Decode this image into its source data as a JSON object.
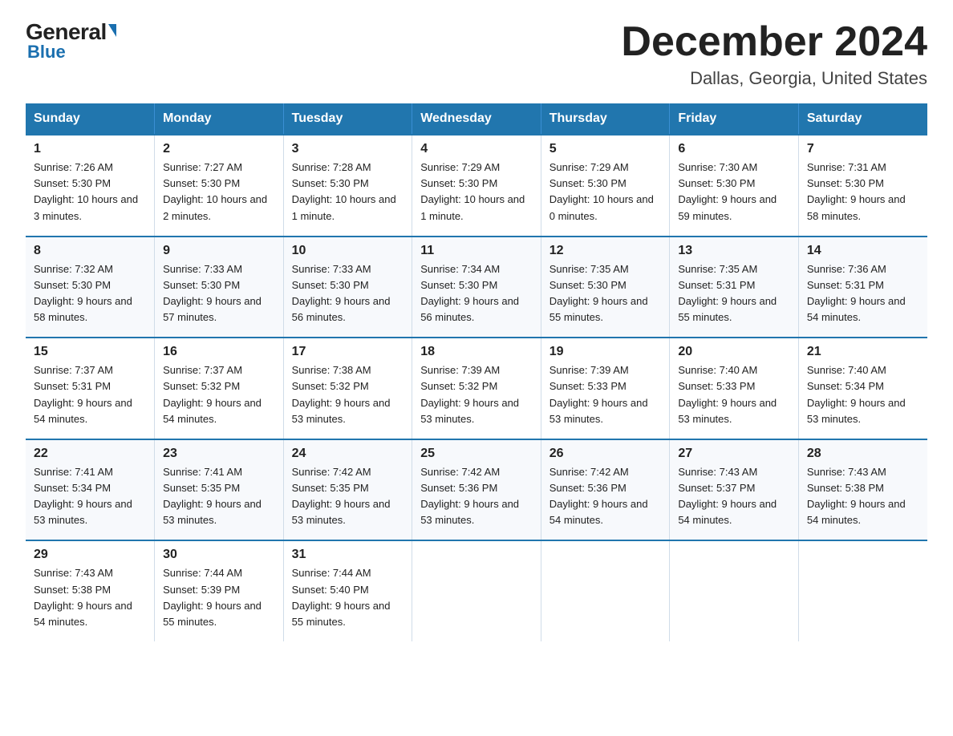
{
  "header": {
    "logo_general": "General",
    "logo_blue": "Blue",
    "title": "December 2024",
    "subtitle": "Dallas, Georgia, United States"
  },
  "days_of_week": [
    "Sunday",
    "Monday",
    "Tuesday",
    "Wednesday",
    "Thursday",
    "Friday",
    "Saturday"
  ],
  "weeks": [
    [
      {
        "day": "1",
        "sunrise": "7:26 AM",
        "sunset": "5:30 PM",
        "daylight": "10 hours and 3 minutes."
      },
      {
        "day": "2",
        "sunrise": "7:27 AM",
        "sunset": "5:30 PM",
        "daylight": "10 hours and 2 minutes."
      },
      {
        "day": "3",
        "sunrise": "7:28 AM",
        "sunset": "5:30 PM",
        "daylight": "10 hours and 1 minute."
      },
      {
        "day": "4",
        "sunrise": "7:29 AM",
        "sunset": "5:30 PM",
        "daylight": "10 hours and 1 minute."
      },
      {
        "day": "5",
        "sunrise": "7:29 AM",
        "sunset": "5:30 PM",
        "daylight": "10 hours and 0 minutes."
      },
      {
        "day": "6",
        "sunrise": "7:30 AM",
        "sunset": "5:30 PM",
        "daylight": "9 hours and 59 minutes."
      },
      {
        "day": "7",
        "sunrise": "7:31 AM",
        "sunset": "5:30 PM",
        "daylight": "9 hours and 58 minutes."
      }
    ],
    [
      {
        "day": "8",
        "sunrise": "7:32 AM",
        "sunset": "5:30 PM",
        "daylight": "9 hours and 58 minutes."
      },
      {
        "day": "9",
        "sunrise": "7:33 AM",
        "sunset": "5:30 PM",
        "daylight": "9 hours and 57 minutes."
      },
      {
        "day": "10",
        "sunrise": "7:33 AM",
        "sunset": "5:30 PM",
        "daylight": "9 hours and 56 minutes."
      },
      {
        "day": "11",
        "sunrise": "7:34 AM",
        "sunset": "5:30 PM",
        "daylight": "9 hours and 56 minutes."
      },
      {
        "day": "12",
        "sunrise": "7:35 AM",
        "sunset": "5:30 PM",
        "daylight": "9 hours and 55 minutes."
      },
      {
        "day": "13",
        "sunrise": "7:35 AM",
        "sunset": "5:31 PM",
        "daylight": "9 hours and 55 minutes."
      },
      {
        "day": "14",
        "sunrise": "7:36 AM",
        "sunset": "5:31 PM",
        "daylight": "9 hours and 54 minutes."
      }
    ],
    [
      {
        "day": "15",
        "sunrise": "7:37 AM",
        "sunset": "5:31 PM",
        "daylight": "9 hours and 54 minutes."
      },
      {
        "day": "16",
        "sunrise": "7:37 AM",
        "sunset": "5:32 PM",
        "daylight": "9 hours and 54 minutes."
      },
      {
        "day": "17",
        "sunrise": "7:38 AM",
        "sunset": "5:32 PM",
        "daylight": "9 hours and 53 minutes."
      },
      {
        "day": "18",
        "sunrise": "7:39 AM",
        "sunset": "5:32 PM",
        "daylight": "9 hours and 53 minutes."
      },
      {
        "day": "19",
        "sunrise": "7:39 AM",
        "sunset": "5:33 PM",
        "daylight": "9 hours and 53 minutes."
      },
      {
        "day": "20",
        "sunrise": "7:40 AM",
        "sunset": "5:33 PM",
        "daylight": "9 hours and 53 minutes."
      },
      {
        "day": "21",
        "sunrise": "7:40 AM",
        "sunset": "5:34 PM",
        "daylight": "9 hours and 53 minutes."
      }
    ],
    [
      {
        "day": "22",
        "sunrise": "7:41 AM",
        "sunset": "5:34 PM",
        "daylight": "9 hours and 53 minutes."
      },
      {
        "day": "23",
        "sunrise": "7:41 AM",
        "sunset": "5:35 PM",
        "daylight": "9 hours and 53 minutes."
      },
      {
        "day": "24",
        "sunrise": "7:42 AM",
        "sunset": "5:35 PM",
        "daylight": "9 hours and 53 minutes."
      },
      {
        "day": "25",
        "sunrise": "7:42 AM",
        "sunset": "5:36 PM",
        "daylight": "9 hours and 53 minutes."
      },
      {
        "day": "26",
        "sunrise": "7:42 AM",
        "sunset": "5:36 PM",
        "daylight": "9 hours and 54 minutes."
      },
      {
        "day": "27",
        "sunrise": "7:43 AM",
        "sunset": "5:37 PM",
        "daylight": "9 hours and 54 minutes."
      },
      {
        "day": "28",
        "sunrise": "7:43 AM",
        "sunset": "5:38 PM",
        "daylight": "9 hours and 54 minutes."
      }
    ],
    [
      {
        "day": "29",
        "sunrise": "7:43 AM",
        "sunset": "5:38 PM",
        "daylight": "9 hours and 54 minutes."
      },
      {
        "day": "30",
        "sunrise": "7:44 AM",
        "sunset": "5:39 PM",
        "daylight": "9 hours and 55 minutes."
      },
      {
        "day": "31",
        "sunrise": "7:44 AM",
        "sunset": "5:40 PM",
        "daylight": "9 hours and 55 minutes."
      },
      null,
      null,
      null,
      null
    ]
  ]
}
